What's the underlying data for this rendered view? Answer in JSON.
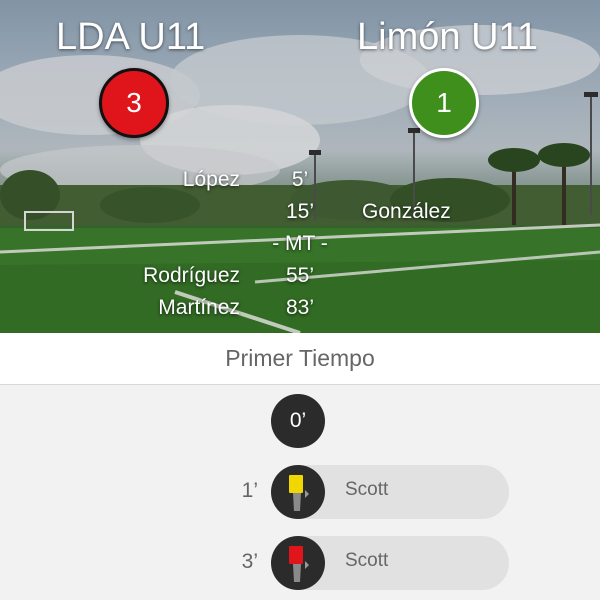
{
  "match": {
    "home_team": "LDA U11",
    "away_team": "Limón U11",
    "home_score": "3",
    "away_score": "1",
    "colors": {
      "home": "#e0141b",
      "away": "#3f8f1d"
    }
  },
  "goals": [
    {
      "home": "López",
      "minute": "5’",
      "away": ""
    },
    {
      "home": "",
      "minute": "15’",
      "away": "González"
    },
    {
      "home": "",
      "minute": "- MT -",
      "away": ""
    },
    {
      "home": "Rodríguez",
      "minute": "55’",
      "away": ""
    },
    {
      "home": "Martínez",
      "minute": "83’",
      "away": ""
    }
  ],
  "section": {
    "title": "Primer Tiempo"
  },
  "timeline": {
    "start_minute": "0’",
    "events": [
      {
        "minute": "1’",
        "player": "Scott",
        "card": "yellow-card-icon",
        "color": "#f2d600"
      },
      {
        "minute": "3’",
        "player": "Scott",
        "card": "red-card-icon",
        "color": "#e0141b"
      }
    ]
  }
}
